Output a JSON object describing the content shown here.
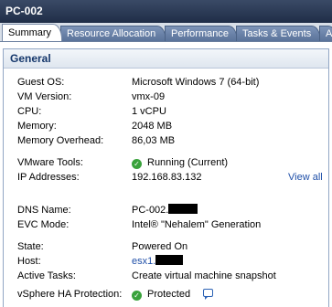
{
  "window": {
    "title": "PC-002"
  },
  "tabs": [
    {
      "label": "Summary",
      "active": true
    },
    {
      "label": "Resource Allocation",
      "active": false
    },
    {
      "label": "Performance",
      "active": false
    },
    {
      "label": "Tasks & Events",
      "active": false
    },
    {
      "label": "A",
      "active": false
    }
  ],
  "general": {
    "header": "General",
    "guest_os": {
      "label": "Guest OS:",
      "value": "Microsoft Windows 7 (64-bit)"
    },
    "vm_version": {
      "label": "VM Version:",
      "value": "vmx-09"
    },
    "cpu": {
      "label": "CPU:",
      "value": "1 vCPU"
    },
    "memory": {
      "label": "Memory:",
      "value": "2048 MB"
    },
    "memory_overhead": {
      "label": "Memory Overhead:",
      "value": "86,03 MB"
    },
    "vmware_tools": {
      "label": "VMware Tools:",
      "value": "Running (Current)",
      "icon": "status-ok-icon"
    },
    "ip_addresses": {
      "label": "IP Addresses:",
      "value": "192.168.83.132",
      "link": "View all"
    },
    "dns_name": {
      "label": "DNS Name:",
      "value": "PC-002."
    },
    "evc_mode": {
      "label": "EVC Mode:",
      "value": "Intel® \"Nehalem\" Generation"
    },
    "state": {
      "label": "State:",
      "value": "Powered On"
    },
    "host": {
      "label": "Host:",
      "value": "esx1."
    },
    "active_tasks": {
      "label": "Active Tasks:",
      "value": "Create virtual machine snapshot"
    },
    "ha_protection": {
      "label": "vSphere HA Protection:",
      "value": "Protected",
      "icon": "status-ok-icon"
    }
  },
  "colors": {
    "link": "#1f4fa8",
    "ok": "#39a23b",
    "title_bg": "#1f2d47",
    "header_text": "#15376b"
  }
}
